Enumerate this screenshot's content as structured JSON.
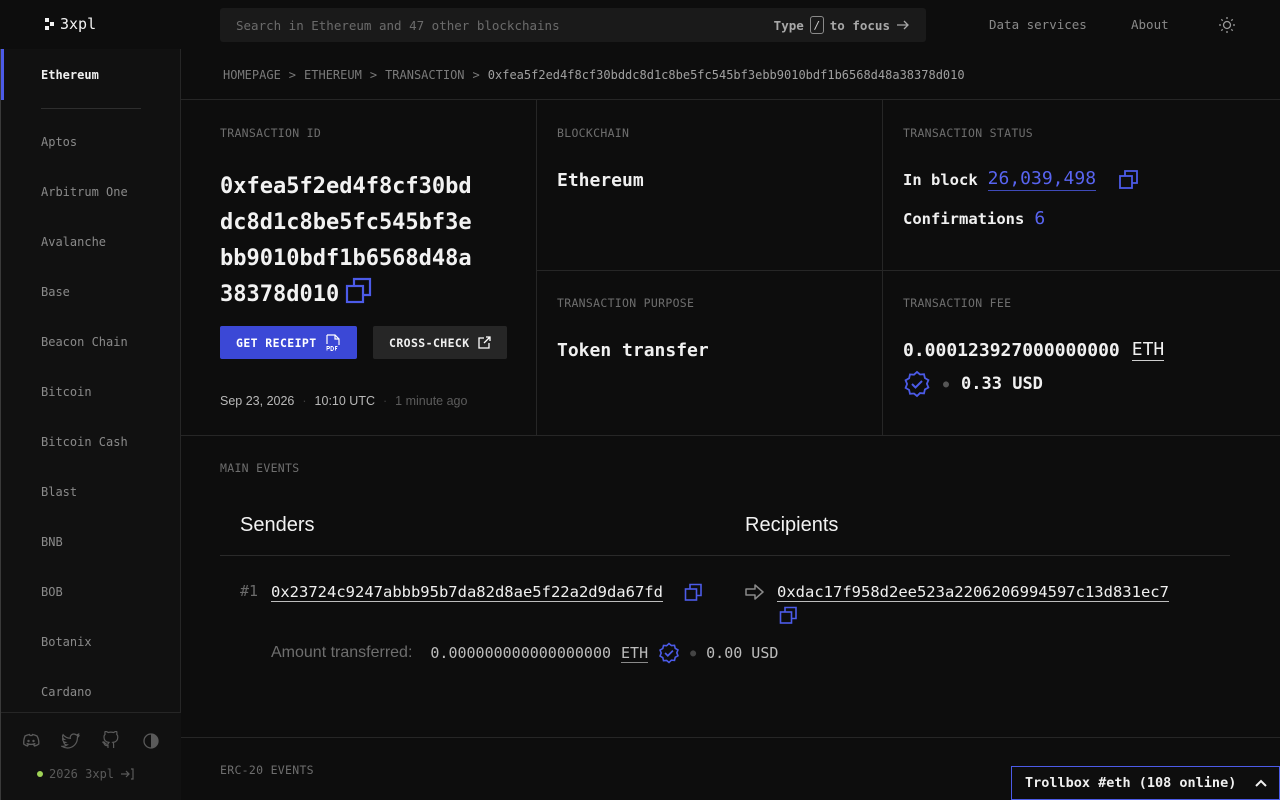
{
  "header": {
    "logo_text": "3xpl",
    "search_placeholder": "Search in Ethereum and 47 other blockchains",
    "search_hint_prefix": "Type",
    "search_hint_key": "/",
    "search_hint_suffix": "to focus",
    "nav": [
      "Data services",
      "About"
    ]
  },
  "sidebar": {
    "active": "Ethereum",
    "items": [
      "Aptos",
      "Arbitrum One",
      "Avalanche",
      "Base",
      "Beacon Chain",
      "Bitcoin",
      "Bitcoin Cash",
      "Blast",
      "BNB",
      "BOB",
      "Botanix",
      "Cardano"
    ],
    "copyright": "2026 3xpl"
  },
  "breadcrumb": {
    "items": [
      "HOMEPAGE",
      "ETHEREUM",
      "TRANSACTION"
    ],
    "current": "0xfea5f2ed4f8cf30bddc8d1c8be5fc545bf3ebb9010bdf1b6568d48a38378d010"
  },
  "transaction": {
    "id_label": "TRANSACTION ID",
    "id": "0xfea5f2ed4f8cf30bddc8d1c8be5fc545bf3ebb9010bdf1b6568d48a38378d010",
    "receipt_button": "GET RECEIPT",
    "crosscheck_button": "CROSS-CHECK",
    "date": "Sep 23, 2026",
    "time": "10:10 UTC",
    "ago": "1 minute ago",
    "blockchain_label": "BLOCKCHAIN",
    "blockchain": "Ethereum",
    "status_label": "TRANSACTION STATUS",
    "in_block_label": "In block",
    "block": "26,039,498",
    "confirmations_label": "Confirmations",
    "confirmations": "6",
    "purpose_label": "TRANSACTION PURPOSE",
    "purpose": "Token transfer",
    "fee_label": "TRANSACTION FEE",
    "fee": "0.000123927000000000",
    "fee_unit": "ETH",
    "fee_usd": "0.33 USD"
  },
  "events": {
    "main_label": "MAIN EVENTS",
    "senders_title": "Senders",
    "recipients_title": "Recipients",
    "index": "#1",
    "sender": "0x23724c9247abbb95b7da82d8ae5f22a2d9da67fd",
    "recipient": "0xdac17f958d2ee523a2206206994597c13d831ec7",
    "amount_label": "Amount transferred:",
    "amount": "0.000000000000000000",
    "amount_unit": "ETH",
    "amount_usd": "0.00 USD",
    "erc20_label": "ERC-20 EVENTS"
  },
  "trollbox": {
    "label": "Trollbox #eth (108 online)"
  },
  "colors": {
    "accent": "#4c5be8",
    "link": "#5864f0",
    "background": "#0d0d0d"
  }
}
